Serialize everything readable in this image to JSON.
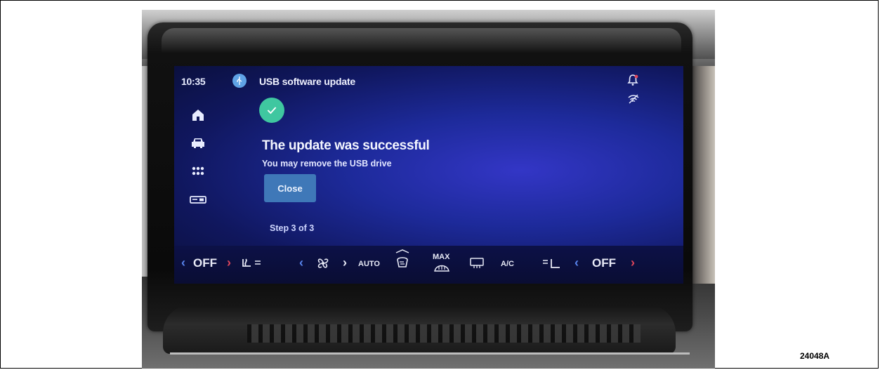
{
  "status": {
    "time": "10:35",
    "app_title": "USB software update"
  },
  "sidebar": {
    "items": [
      {
        "icon": "home-icon"
      },
      {
        "icon": "car-icon"
      },
      {
        "icon": "apps-icon"
      },
      {
        "icon": "media-icon"
      }
    ]
  },
  "update": {
    "headline": "The update was successful",
    "subline": "You may remove the USB drive",
    "close_label": "Close",
    "step_text": "Step 3 of 3"
  },
  "climate": {
    "left_off": "OFF",
    "right_off": "OFF",
    "auto_label": "AUTO",
    "max_label": "MAX",
    "ac_label": "A/C"
  },
  "figure": {
    "id": "24048A"
  },
  "colors": {
    "accent_check": "#3fc7a0",
    "close_button": "#3f78b8",
    "usb_badge": "#5fa3e6",
    "arrow_blue": "#5a86f0",
    "arrow_red": "#e0455a"
  }
}
